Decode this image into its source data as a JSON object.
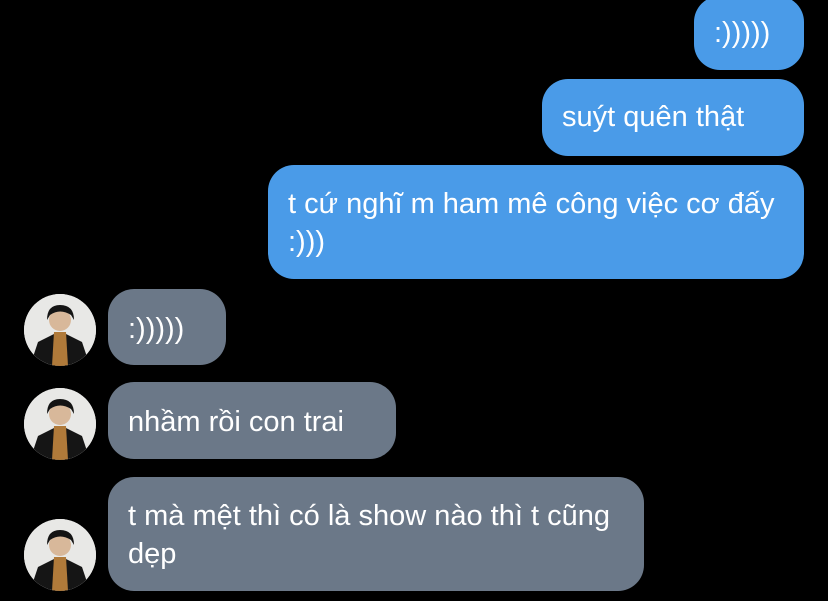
{
  "colors": {
    "background": "#000000",
    "sent_bubble": "#4a9be8",
    "received_bubble": "#6b7888",
    "text": "#ffffff"
  },
  "messages": [
    {
      "id": 0,
      "direction": "sent",
      "text": ":)))))"
    },
    {
      "id": 1,
      "direction": "sent",
      "text": "suýt quên thật"
    },
    {
      "id": 2,
      "direction": "sent",
      "text": "t cứ nghĩ m ham mê công việc cơ đấy :)))"
    },
    {
      "id": 3,
      "direction": "received",
      "text": ":)))))"
    },
    {
      "id": 4,
      "direction": "received",
      "text": "nhầm rồi con trai"
    },
    {
      "id": 5,
      "direction": "received",
      "text": "t mà mệt thì có là show nào thì t cũng dẹp"
    }
  ],
  "avatar_icon": "contact-avatar-icon"
}
